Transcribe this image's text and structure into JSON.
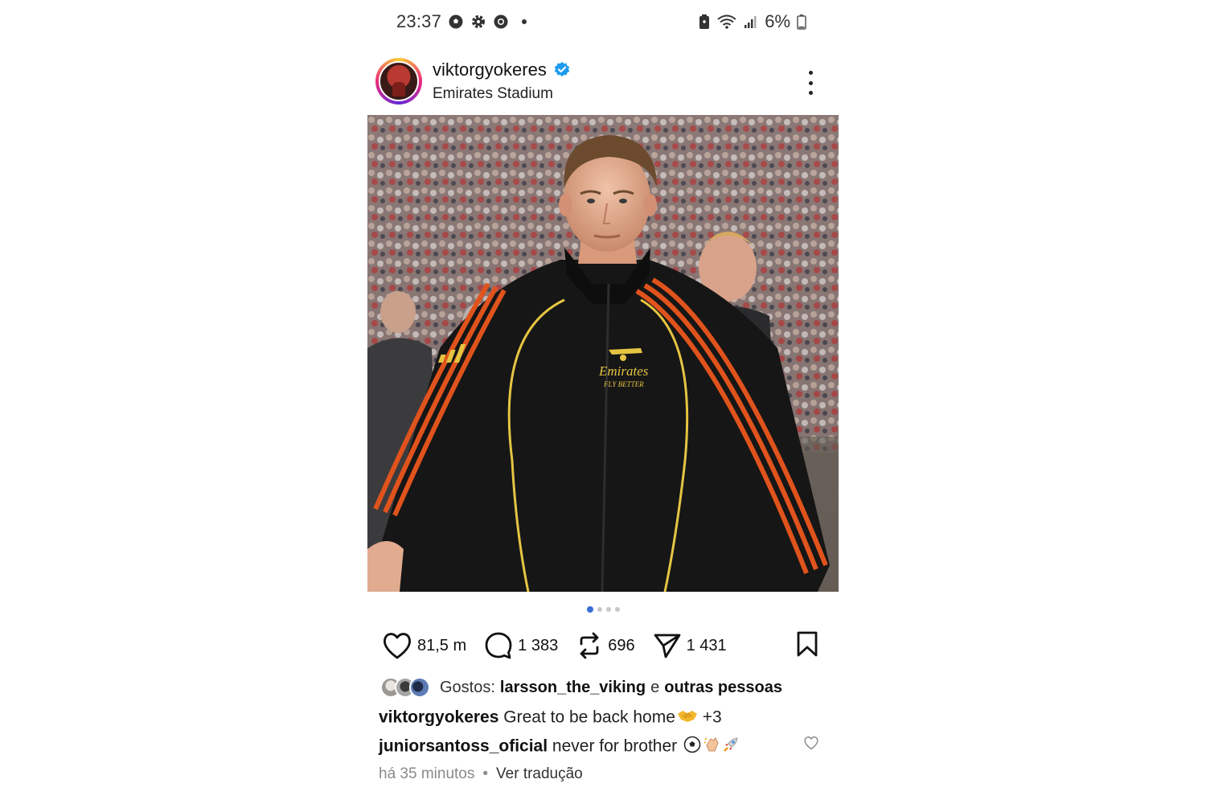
{
  "status_bar": {
    "time": "23:37",
    "left_icons": [
      "football-icon",
      "gear-icon",
      "chrome-icon",
      "dot-icon"
    ],
    "right_icons": [
      "battery-saver-icon",
      "wifi-icon",
      "signal-icon",
      "battery-icon"
    ],
    "battery_percent": "6%"
  },
  "post": {
    "username": "viktorgyokeres",
    "verified": true,
    "location": "Emirates Stadium",
    "media": {
      "jacket_text": "Emirates",
      "jacket_subtext": "FLY BETTER",
      "carousel_count": 4,
      "carousel_active_index": 0
    },
    "actions": {
      "likes": "81,5 m",
      "comments": "1 383",
      "reposts": "696",
      "shares": "1 431"
    },
    "liked_by": {
      "prefix": "Gostos:",
      "user": "larsson_the_viking",
      "connector": "e",
      "others": "outras pessoas"
    },
    "caption": {
      "user": "viktorgyokeres",
      "text": "Great to be back home",
      "emoji": "handshake",
      "extra": "+3"
    },
    "top_comment": {
      "user": "juniorsantoss_oficial",
      "text": "never for brother"
    },
    "time_ago": "há 35 minutos",
    "separator": "•",
    "translate_label": "Ver tradução"
  },
  "colors": {
    "accent_blue": "#3b6fd8",
    "verified_blue": "#1d9bf0",
    "jacket_black": "#161616",
    "stripe_orange": "#e0531c",
    "trim_gold": "#e5c542"
  }
}
